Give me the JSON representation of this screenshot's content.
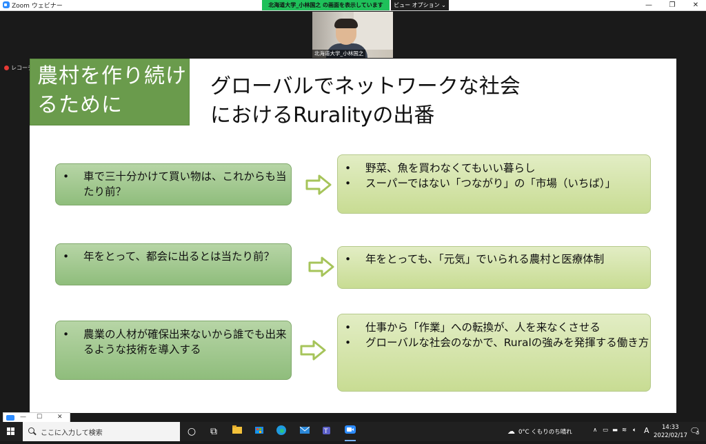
{
  "window": {
    "title": "Zoom ウェビナー",
    "share_banner": "北海道大学_小林国之 の画面を表示しています",
    "view_options": "ビュー オプション ⌄",
    "minimize": "—",
    "restore": "❐",
    "close": "✕"
  },
  "video": {
    "participant_name": "北海道大学_小林国之"
  },
  "recording": {
    "label": "レコーディング"
  },
  "slide": {
    "title_box": "農村を作り続けるために",
    "title": "グローバルでネットワークな社会\nにおけるRuralityの出番",
    "rows": [
      {
        "left": [
          "車で三十分かけて買い物は、これからも当たり前？"
        ],
        "right": [
          "野菜、魚を買わなくてもいい暮らし",
          "スーパーではない「つながり」の「市場（いちば）」"
        ]
      },
      {
        "left": [
          "年をとって、都会に出るとは当たり前？"
        ],
        "right": [
          "年をとっても、「元気」でいられる農村と医療体制"
        ]
      },
      {
        "left": [
          "農業の人材が確保出来ないから誰でも出来るような技術を導入する"
        ],
        "right": [
          "仕事から「作業」への転換が、人を来なくさせる",
          "グローバルな社会のなかで、Ruralの強みを発揮する働き方"
        ]
      }
    ],
    "colors": {
      "title_box": "#6a9b4c",
      "left_box": "#9cc589",
      "right_box": "#d3e3a8",
      "arrow": "#a6c45a"
    }
  },
  "mini_window": {
    "minimize": "—",
    "maximize": "☐",
    "close": "✕"
  },
  "taskbar": {
    "search_placeholder": "ここに入力して検索",
    "weather": "0°C  くもりのち晴れ",
    "time": "14:33",
    "date": "2022/02/17",
    "ime": "A",
    "notification_count": "5"
  }
}
